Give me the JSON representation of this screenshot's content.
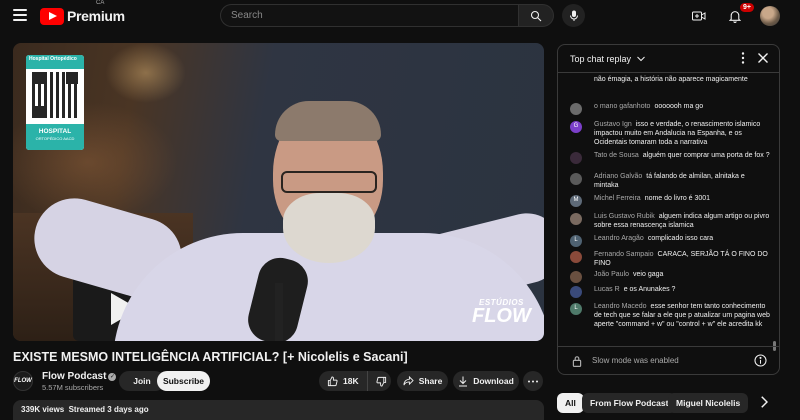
{
  "header": {
    "logo_text": "Premium",
    "logo_country": "CA",
    "search_placeholder": "Search",
    "notification_count": "9+"
  },
  "video": {
    "overlay_qr_top": "Hospital Ortopédico",
    "overlay_qr_bottom": "HOSPITAL",
    "overlay_qr_bottom_small": "ORTOPÉDICO AACD",
    "overlay_studio_line1": "ESTÚDIOS",
    "overlay_studio_line2": "FLOW"
  },
  "title": "EXISTE MESMO INTELIGÊNCIA ARTIFICIAL? [+ Nicolelis e Sacani]",
  "channel": {
    "avatar_text": "FLOW",
    "name": "Flow Podcast",
    "subscribers": "5.57M subscribers",
    "join_label": "Join",
    "subscribe_label": "Subscribe"
  },
  "actions": {
    "likes": "18K",
    "share_label": "Share",
    "download_label": "Download"
  },
  "description": {
    "views": "339K views",
    "streamed": "Streamed 3 days ago"
  },
  "chat": {
    "header_title": "Top chat replay",
    "slow_mode": "Slow mode was enabled",
    "messages": [
      {
        "author": "",
        "text": "foi a milhares de anos atrás. Paleontologia e história não émagia, a história não aparece magicamente",
        "avatar": "",
        "avatar_color": "#0f0f0f"
      },
      {
        "author": "o mano gafanhoto",
        "text": "ooooooh ma go",
        "avatar": "",
        "avatar_color": "#6b6b6b"
      },
      {
        "author": "Gustavo Ign",
        "text": "isso e verdade, o renascimento islamico impactou muito em Andalucia na Espanha, e os Ocidentais tomaram toda a narrativa",
        "avatar": "G",
        "avatar_color": "#7b3fc9"
      },
      {
        "author": "Tato de Sousa",
        "text": "alguém quer comprar uma porta de fox ?",
        "avatar": "",
        "avatar_color": "#3a2a3a"
      },
      {
        "author": "Adriano Galvão",
        "text": "tá falando de almilan, alnitaka e mintaka",
        "avatar": "",
        "avatar_color": "#5a5a5a"
      },
      {
        "author": "Michel Ferreira",
        "text": "nome do livro é 3001",
        "avatar": "M",
        "avatar_color": "#5e6a78"
      },
      {
        "author": "Luis Gustavo Rubik",
        "text": "alguem indica algum artigo ou pivro sobre essa renascença islamica",
        "avatar": "",
        "avatar_color": "#7a6a60"
      },
      {
        "author": "Leandro Aragão",
        "text": "complicado isso cara",
        "avatar": "L",
        "avatar_color": "#4f6272"
      },
      {
        "author": "Fernando Sampaio",
        "text": "CARACA, SERJÃO TÁ O FINO DO FINO",
        "avatar": "",
        "avatar_color": "#8a4a3a"
      },
      {
        "author": "João Paulo",
        "text": "veio gaga",
        "avatar": "",
        "avatar_color": "#6a5040"
      },
      {
        "author": "Lucas R",
        "text": "e os Anunakes ?",
        "avatar": "",
        "avatar_color": "#3a4a7a"
      },
      {
        "author": "Leandro Macedo",
        "text": "esse senhor tem tanto conhecimento de tech que se falar a ele que p atualizar um pagina web aperte \"command + w\" ou \"control + w\" ele acredita kk",
        "avatar": "L",
        "avatar_color": "#4f7a6a"
      }
    ]
  },
  "chips": [
    "All",
    "From Flow Podcast",
    "Miguel Nicolelis"
  ],
  "colors": {
    "background": "#0f0f0f",
    "surface": "#272727",
    "text": "#f1f1f1",
    "muted": "#aaaaaa",
    "brand_red": "#ff0000",
    "badge_red": "#cc0000",
    "qr_teal": "#2bb3a9"
  },
  "icons": [
    "menu-icon",
    "youtube-logo-icon",
    "search-icon",
    "mic-icon",
    "create-icon",
    "bell-icon",
    "thumbs-up-icon",
    "thumbs-down-icon",
    "share-icon",
    "download-icon",
    "more-icon",
    "chevron-down-icon",
    "kebab-icon",
    "close-icon",
    "lock-icon",
    "info-icon",
    "chevron-right-icon"
  ]
}
